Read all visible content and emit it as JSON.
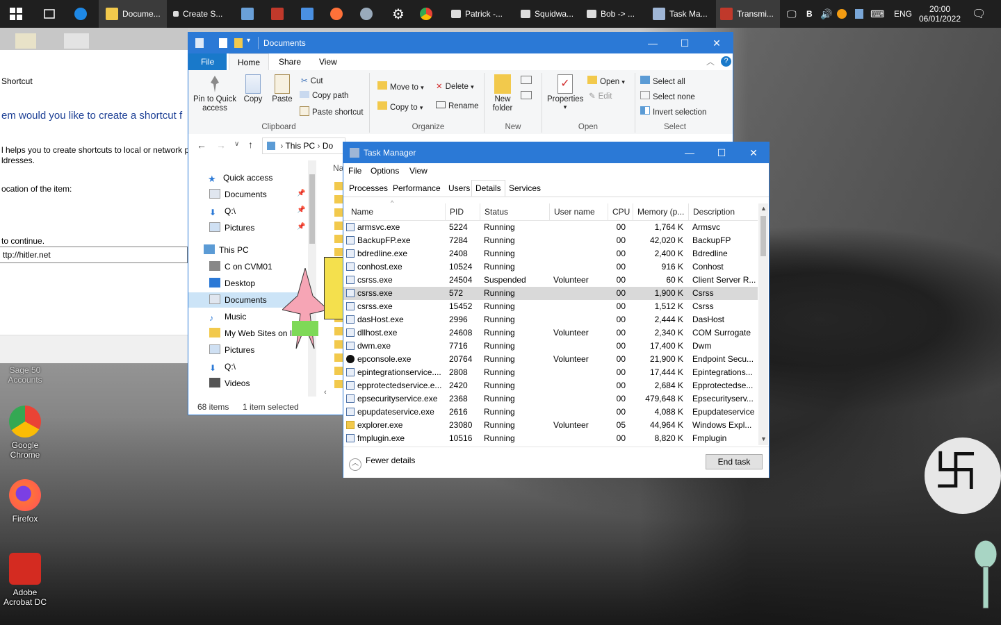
{
  "taskbar": {
    "items": [
      {
        "label": "Docume..."
      },
      {
        "label": "Create S..."
      },
      {
        "label": "Patrick -..."
      },
      {
        "label": "Squidwa..."
      },
      {
        "label": "Bob -> ..."
      },
      {
        "label": "Task Ma..."
      },
      {
        "label": "Transmi..."
      }
    ],
    "tray": {
      "b": "B",
      "lang": "ENG",
      "time": "20:00",
      "date": "06/01/2022"
    }
  },
  "wizard": {
    "lines": [
      "Shortcut",
      "em would you like to create a shortcut f",
      "l helps you to create shortcuts to local or network p",
      "ldresses.",
      "ocation of the item:",
      "to continue."
    ],
    "input_value": "ttp://hitler.net"
  },
  "desktop": {
    "icons": [
      {
        "label": "Sage 50 Accounts"
      },
      {
        "label": "Google Chrome"
      },
      {
        "label": "Firefox"
      },
      {
        "label": "Adobe Acrobat DC"
      }
    ]
  },
  "explorer": {
    "title": "Documents",
    "ribbon_tabs": [
      "File",
      "Home",
      "Share",
      "View"
    ],
    "clipboard": {
      "pin": "Pin to Quick access",
      "copy": "Copy",
      "paste": "Paste",
      "cut": "Cut",
      "copy_path": "Copy path",
      "paste_shortcut": "Paste shortcut",
      "group": "Clipboard"
    },
    "organize": {
      "move_to": "Move to",
      "copy_to": "Copy to",
      "delete": "Delete",
      "rename": "Rename",
      "group": "Organize"
    },
    "new": {
      "new_folder": "New folder",
      "group": "New"
    },
    "open": {
      "properties": "Properties",
      "open": "Open",
      "edit": "Edit",
      "group": "Open"
    },
    "select": {
      "select_all": "Select all",
      "select_none": "Select none",
      "invert": "Invert selection",
      "group": "Select"
    },
    "address": {
      "this_pc": "This PC",
      "current": "Do"
    },
    "column_header": "Na",
    "nav": [
      {
        "label": "Quick access"
      },
      {
        "label": "Documents"
      },
      {
        "label": "Q:\\"
      },
      {
        "label": "Pictures"
      },
      {
        "label": "This PC"
      },
      {
        "label": "C on CVM01"
      },
      {
        "label": "Desktop"
      },
      {
        "label": "Documents"
      },
      {
        "label": "Music"
      },
      {
        "label": "My Web Sites on I"
      },
      {
        "label": "Pictures"
      },
      {
        "label": "Q:\\"
      },
      {
        "label": "Videos"
      }
    ],
    "status": {
      "items": "68 items",
      "selected": "1 item selected"
    }
  },
  "taskmgr": {
    "title": "Task Manager",
    "menu": [
      "File",
      "Options",
      "View"
    ],
    "tabs": [
      "Processes",
      "Performance",
      "Users",
      "Details",
      "Services"
    ],
    "selected_tab": "Details",
    "columns": [
      "Name",
      "PID",
      "Status",
      "User name",
      "CPU",
      "Memory (p...",
      "Description"
    ],
    "rows": [
      {
        "name": "armsvc.exe",
        "pid": "5224",
        "status": "Running",
        "user": "",
        "cpu": "00",
        "mem": "1,764 K",
        "desc": "Armsvc"
      },
      {
        "name": "BackupFP.exe",
        "pid": "7284",
        "status": "Running",
        "user": "",
        "cpu": "00",
        "mem": "42,020 K",
        "desc": "BackupFP"
      },
      {
        "name": "bdredline.exe",
        "pid": "2408",
        "status": "Running",
        "user": "",
        "cpu": "00",
        "mem": "2,400 K",
        "desc": "Bdredline"
      },
      {
        "name": "conhost.exe",
        "pid": "10524",
        "status": "Running",
        "user": "",
        "cpu": "00",
        "mem": "916 K",
        "desc": "Conhost"
      },
      {
        "name": "csrss.exe",
        "pid": "24504",
        "status": "Suspended",
        "user": "Volunteer",
        "cpu": "00",
        "mem": "60 K",
        "desc": "Client Server R..."
      },
      {
        "name": "csrss.exe",
        "pid": "572",
        "status": "Running",
        "user": "",
        "cpu": "00",
        "mem": "1,900 K",
        "desc": "Csrss"
      },
      {
        "name": "csrss.exe",
        "pid": "15452",
        "status": "Running",
        "user": "",
        "cpu": "00",
        "mem": "1,512 K",
        "desc": "Csrss"
      },
      {
        "name": "dasHost.exe",
        "pid": "2996",
        "status": "Running",
        "user": "",
        "cpu": "00",
        "mem": "2,444 K",
        "desc": "DasHost"
      },
      {
        "name": "dllhost.exe",
        "pid": "24608",
        "status": "Running",
        "user": "Volunteer",
        "cpu": "00",
        "mem": "2,340 K",
        "desc": "COM Surrogate"
      },
      {
        "name": "dwm.exe",
        "pid": "7716",
        "status": "Running",
        "user": "",
        "cpu": "00",
        "mem": "17,400 K",
        "desc": "Dwm"
      },
      {
        "name": "epconsole.exe",
        "pid": "20764",
        "status": "Running",
        "user": "Volunteer",
        "cpu": "00",
        "mem": "21,900 K",
        "desc": "Endpoint Secu..."
      },
      {
        "name": "epintegrationservice....",
        "pid": "2808",
        "status": "Running",
        "user": "",
        "cpu": "00",
        "mem": "17,444 K",
        "desc": "Epintegrations..."
      },
      {
        "name": "epprotectedservice.e...",
        "pid": "2420",
        "status": "Running",
        "user": "",
        "cpu": "00",
        "mem": "2,684 K",
        "desc": "Epprotectedse..."
      },
      {
        "name": "epsecurityservice.exe",
        "pid": "2368",
        "status": "Running",
        "user": "",
        "cpu": "00",
        "mem": "479,648 K",
        "desc": "Epsecurityserv..."
      },
      {
        "name": "epupdateservice.exe",
        "pid": "2616",
        "status": "Running",
        "user": "",
        "cpu": "00",
        "mem": "4,088 K",
        "desc": "Epupdateservice"
      },
      {
        "name": "explorer.exe",
        "pid": "23080",
        "status": "Running",
        "user": "Volunteer",
        "cpu": "05",
        "mem": "44,964 K",
        "desc": "Windows Expl..."
      },
      {
        "name": "fmplugin.exe",
        "pid": "10516",
        "status": "Running",
        "user": "",
        "cpu": "00",
        "mem": "8,820 K",
        "desc": "Fmplugin"
      }
    ],
    "selected_row": 5,
    "fewer_details": "Fewer details",
    "end_task": "End task"
  },
  "colors": {
    "accent": "#2b79d6",
    "taskbar": "#1f1f1f",
    "ribbon": "#f5f6f7"
  }
}
